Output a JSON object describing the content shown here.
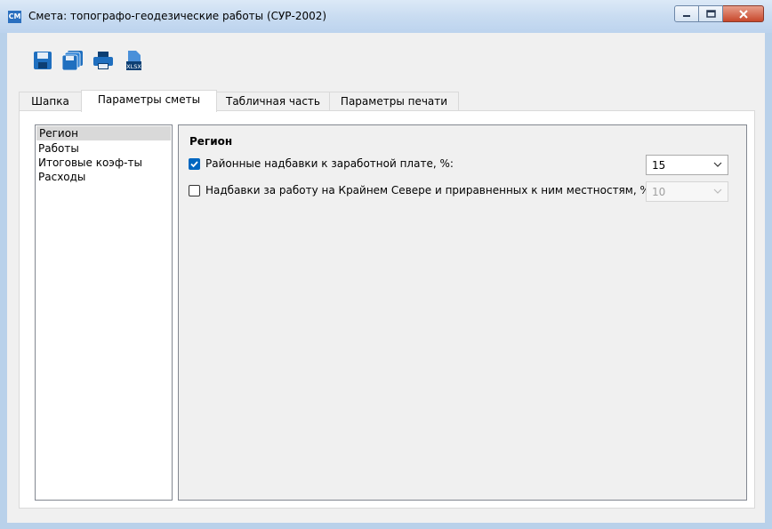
{
  "window": {
    "app_icon_text": "СМ",
    "title": "Смета: топографо-геодезические работы (СУР-2002)"
  },
  "toolbar": {
    "buttons": [
      {
        "icon": "save-icon"
      },
      {
        "icon": "save-all-icon"
      },
      {
        "icon": "print-icon"
      },
      {
        "icon": "export-xlsx-icon",
        "label": "XLSX"
      }
    ]
  },
  "tabs": [
    {
      "label": "Шапка"
    },
    {
      "label": "Параметры сметы"
    },
    {
      "label": "Табличная часть"
    },
    {
      "label": "Параметры печати"
    }
  ],
  "active_tab": "Параметры сметы",
  "sidebar": {
    "items": [
      {
        "label": "Регион",
        "selected": true
      },
      {
        "label": "Работы"
      },
      {
        "label": "Итоговые коэф-ты"
      },
      {
        "label": "Расходы"
      }
    ]
  },
  "region": {
    "title": "Регион",
    "wage_allowance": {
      "label": "Районные надбавки к заработной плате, %:",
      "checked": true,
      "value": "15"
    },
    "north_allowance": {
      "label": "Надбавки за работу на Крайнем Севере и приравненных к ним местностям, %:",
      "checked": false,
      "value": "10"
    }
  },
  "colors": {
    "accent": "#0067c0",
    "titlebar": "#c9dcf1",
    "selection": "#d9d9d9"
  }
}
